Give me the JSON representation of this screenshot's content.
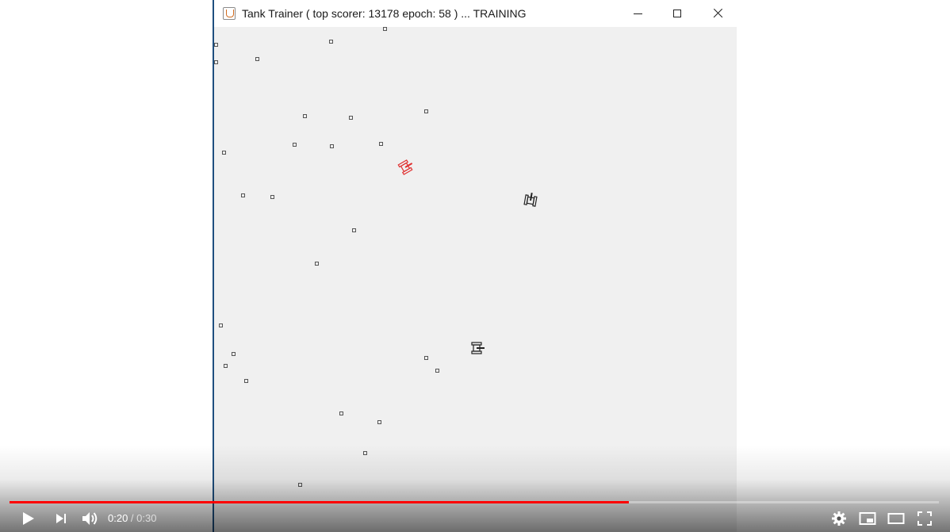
{
  "window": {
    "title": "Tank Trainer ( top scorer: 13178 epoch: 58 ) ... TRAINING",
    "app_icon": "java-cup-icon",
    "controls": [
      "minimize-icon",
      "maximize-icon",
      "close-icon"
    ]
  },
  "arena": {
    "background": "#f0f0f0",
    "obstacle_color": "#555555",
    "obstacle_count": 28,
    "tanks": [
      {
        "name": "red-tank",
        "color": "#e03030",
        "heading_deg": 60
      },
      {
        "name": "black-tank-east",
        "color": "#222222",
        "heading_deg": 10
      },
      {
        "name": "black-tank-south",
        "color": "#222222",
        "heading_deg": 90
      }
    ]
  },
  "player": {
    "current_time": "0:20",
    "separator": " / ",
    "duration": "0:30",
    "progress_fraction": 0.6667,
    "progress_color": "#ff0000",
    "left_controls": [
      "play-icon",
      "next-icon",
      "volume-icon"
    ],
    "right_controls": [
      "settings-icon",
      "miniplayer-icon",
      "theater-mode-icon",
      "fullscreen-icon"
    ]
  }
}
